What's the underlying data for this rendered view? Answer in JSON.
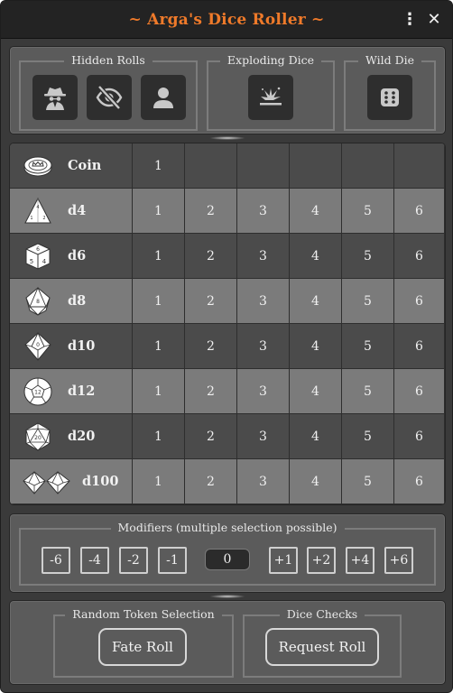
{
  "window": {
    "title": "~ Arga's Dice Roller ~",
    "menu_icon": "kebab-menu-icon",
    "close_icon": "close-icon",
    "title_color": "#ef7a2a"
  },
  "roll_options": {
    "hidden_rolls": {
      "legend": "Hidden Rolls",
      "buttons": [
        {
          "icon": "spy-icon"
        },
        {
          "icon": "eye-slash-icon"
        },
        {
          "icon": "user-icon"
        }
      ]
    },
    "exploding_dice": {
      "legend": "Exploding Dice",
      "icon": "explosion-icon"
    },
    "wild_die": {
      "legend": "Wild Die",
      "icon": "dice-icon"
    }
  },
  "dice": [
    {
      "label": "Coin",
      "icon": "coin-icon",
      "values": [
        "1"
      ]
    },
    {
      "label": "d4",
      "icon": "d4-icon",
      "values": [
        "1",
        "2",
        "3",
        "4",
        "5",
        "6"
      ]
    },
    {
      "label": "d6",
      "icon": "d6-icon",
      "values": [
        "1",
        "2",
        "3",
        "4",
        "5",
        "6"
      ]
    },
    {
      "label": "d8",
      "icon": "d8-icon",
      "values": [
        "1",
        "2",
        "3",
        "4",
        "5",
        "6"
      ]
    },
    {
      "label": "d10",
      "icon": "d10-icon",
      "values": [
        "1",
        "2",
        "3",
        "4",
        "5",
        "6"
      ]
    },
    {
      "label": "d12",
      "icon": "d12-icon",
      "values": [
        "1",
        "2",
        "3",
        "4",
        "5",
        "6"
      ]
    },
    {
      "label": "d20",
      "icon": "d20-icon",
      "values": [
        "1",
        "2",
        "3",
        "4",
        "5",
        "6"
      ]
    },
    {
      "label": "d100",
      "icon": "d100-icon",
      "values": [
        "1",
        "2",
        "3",
        "4",
        "5",
        "6"
      ]
    }
  ],
  "modifiers": {
    "legend": "Modifiers (multiple selection possible)",
    "negative": [
      "-6",
      "-4",
      "-2",
      "-1"
    ],
    "current": "0",
    "positive": [
      "+1",
      "+2",
      "+4",
      "+6"
    ]
  },
  "bottom": {
    "random_token": {
      "legend": "Random Token Selection",
      "button": "Fate Roll"
    },
    "dice_checks": {
      "legend": "Dice Checks",
      "button": "Request Roll"
    }
  }
}
